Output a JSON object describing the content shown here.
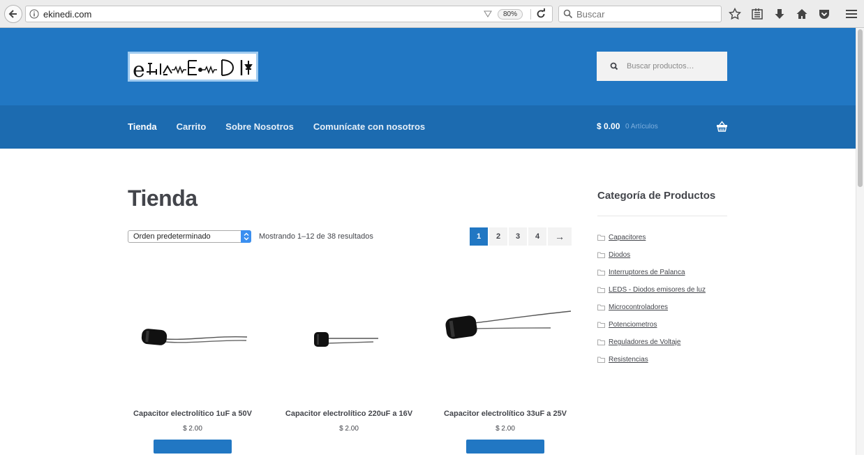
{
  "browser": {
    "url": "ekinedi.com",
    "zoom": "80%",
    "search_placeholder": "Buscar"
  },
  "site": {
    "search_placeholder": "Buscar productos…",
    "nav": [
      "Tienda",
      "Carrito",
      "Sobre Nosotros",
      "Comunícate con nosotros"
    ],
    "cart_total": "$ 0.00",
    "cart_count": "0 Artículos",
    "brand_color": "#2177c3"
  },
  "shop": {
    "title": "Tienda",
    "orderby": "Orden predeterminado",
    "result_count": "Mostrando 1–12 de 38 resultados",
    "pages": [
      "1",
      "2",
      "3",
      "4"
    ],
    "next": "→",
    "products": [
      {
        "name": "Capacitor electrolítico 1uF a 50V",
        "price": "$ 2.00"
      },
      {
        "name": "Capacitor electrolítico 220uF a 16V",
        "price": "$ 2.00"
      },
      {
        "name": "Capacitor electrolítico 33uF a 25V",
        "price": "$ 2.00"
      }
    ]
  },
  "sidebar": {
    "title": "Categoría de Productos",
    "categories": [
      "Capacitores",
      "Diodos",
      "Interruptores de Palanca",
      "LEDS - Diodos emisores de luz",
      "Microcontroladores",
      "Potenciometros",
      "Reguladores de Voltaje",
      "Resistencias"
    ]
  }
}
